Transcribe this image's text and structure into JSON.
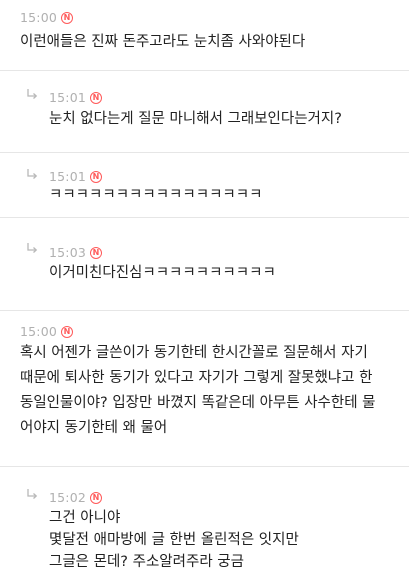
{
  "badge_label": "N",
  "comments": [
    {
      "type": "comment",
      "time": "15:00",
      "text": "이런애들은 진짜 돈주고라도 눈치좀 사와야된다"
    },
    {
      "type": "reply",
      "time": "15:01",
      "text": "눈치 없다는게 질문 마니해서 그래보인다는거지?"
    },
    {
      "type": "reply",
      "time": "15:01",
      "text": "ㅋㅋㅋㅋㅋㅋㅋㅋㅋㅋㅋㅋㅋㅋㅋㅋ"
    },
    {
      "type": "reply",
      "time": "15:03",
      "text": "이거미친다진심ㅋㅋㅋㅋㅋㅋㅋㅋㅋㅋ"
    },
    {
      "type": "comment",
      "time": "15:00",
      "text": "혹시 어젠가 글쓴이가 동기한테 한시간꼴로 질문해서 자기\n때문에 퇴사한 동기가 있다고 자기가 그렇게 잘못했냐고 한\n동일인물이야? 입장만 바꼈지 똑같은데 아무튼 사수한테 물\n어야지 동기한테 왜 물어"
    },
    {
      "type": "reply",
      "time": "15:02",
      "text": "그건 아니야\n몇달전 애마방에 글 한번 올린적은 잇지만\n그글은 몬데? 주소알려주라 궁금"
    }
  ]
}
